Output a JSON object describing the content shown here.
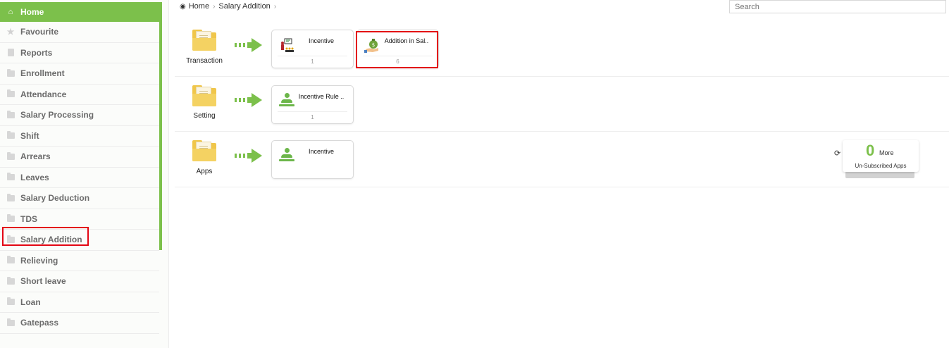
{
  "sidebar": {
    "items": [
      {
        "label": "Home",
        "icon": "home-icon"
      },
      {
        "label": "Favourite",
        "icon": "star-icon"
      },
      {
        "label": "Reports",
        "icon": "document-icon"
      },
      {
        "label": "Enrollment",
        "icon": "folder-icon"
      },
      {
        "label": "Attendance",
        "icon": "folder-icon"
      },
      {
        "label": "Salary Processing",
        "icon": "folder-icon"
      },
      {
        "label": "Shift",
        "icon": "folder-icon"
      },
      {
        "label": "Arrears",
        "icon": "folder-icon"
      },
      {
        "label": "Leaves",
        "icon": "folder-icon"
      },
      {
        "label": "Salary Deduction",
        "icon": "folder-icon"
      },
      {
        "label": "TDS",
        "icon": "folder-icon"
      },
      {
        "label": "Salary Addition",
        "icon": "folder-icon"
      },
      {
        "label": "Relieving",
        "icon": "folder-icon"
      },
      {
        "label": "Short leave",
        "icon": "folder-icon"
      },
      {
        "label": "Loan",
        "icon": "folder-icon"
      },
      {
        "label": "Gatepass",
        "icon": "folder-icon"
      }
    ],
    "accent": "#7cc04b",
    "highlight_color": "#e30613"
  },
  "breadcrumb": {
    "home": "Home",
    "current": "Salary Addition"
  },
  "search": {
    "placeholder": "Search"
  },
  "sections": [
    {
      "label": "Transaction",
      "cards": [
        {
          "title": "Incentive",
          "count": "1",
          "icon": "presenter-icon"
        },
        {
          "title": "Addition in Sal..",
          "count": "6",
          "icon": "money-bag-hand-icon"
        }
      ]
    },
    {
      "label": "Setting",
      "cards": [
        {
          "title": "Incentive Rule ..",
          "count": "1",
          "icon": "person-icon"
        }
      ]
    },
    {
      "label": "Apps",
      "cards": [
        {
          "title": "Incentive",
          "count": "",
          "icon": "person-icon"
        }
      ]
    }
  ],
  "unsubscribed": {
    "count": "0",
    "more": "More",
    "label": "Un-Subscribed Apps"
  }
}
